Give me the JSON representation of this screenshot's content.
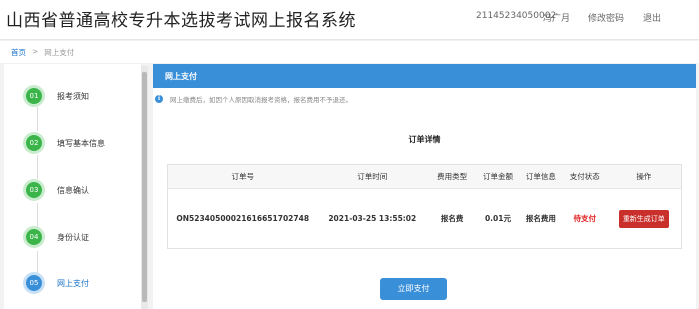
{
  "header": {
    "app_title": "山西省普通高校专升本选拔考试网上报名系统",
    "user_id": "21145234050002",
    "user_name": "冯广月",
    "change_password": "修改密码",
    "logout": "退出"
  },
  "breadcrumb": {
    "home": "首页",
    "separator": ">",
    "current": "网上支付"
  },
  "sidebar": {
    "steps": [
      {
        "num": "01",
        "label": "报考须知"
      },
      {
        "num": "02",
        "label": "填写基本信息"
      },
      {
        "num": "03",
        "label": "信息确认"
      },
      {
        "num": "04",
        "label": "身份认证"
      },
      {
        "num": "05",
        "label": "网上支付"
      }
    ]
  },
  "main": {
    "section_title": "网上支付",
    "notice": "网上缴费后，如因个人原因取消报考资格，报名费用不予退还。",
    "order_title": "订单详情",
    "table": {
      "headers": [
        "订单号",
        "订单时间",
        "费用类型",
        "订单金额",
        "订单信息",
        "支付状态",
        "操作"
      ],
      "row": {
        "order_no": "ON52340500021616651702748",
        "order_time": "2021-03-25 13:55:02",
        "fee_type": "报名费",
        "amount": "0.01元",
        "order_info": "报名费用",
        "status": "待支付",
        "action": "重新生成订单"
      }
    },
    "pay_button": "立即支付"
  },
  "colors": {
    "accent": "#3a8fd9",
    "step_done": "#3bb54a",
    "pending": "#e02020",
    "danger_button": "#c9302c"
  },
  "icons": {
    "notice": "info-icon"
  }
}
